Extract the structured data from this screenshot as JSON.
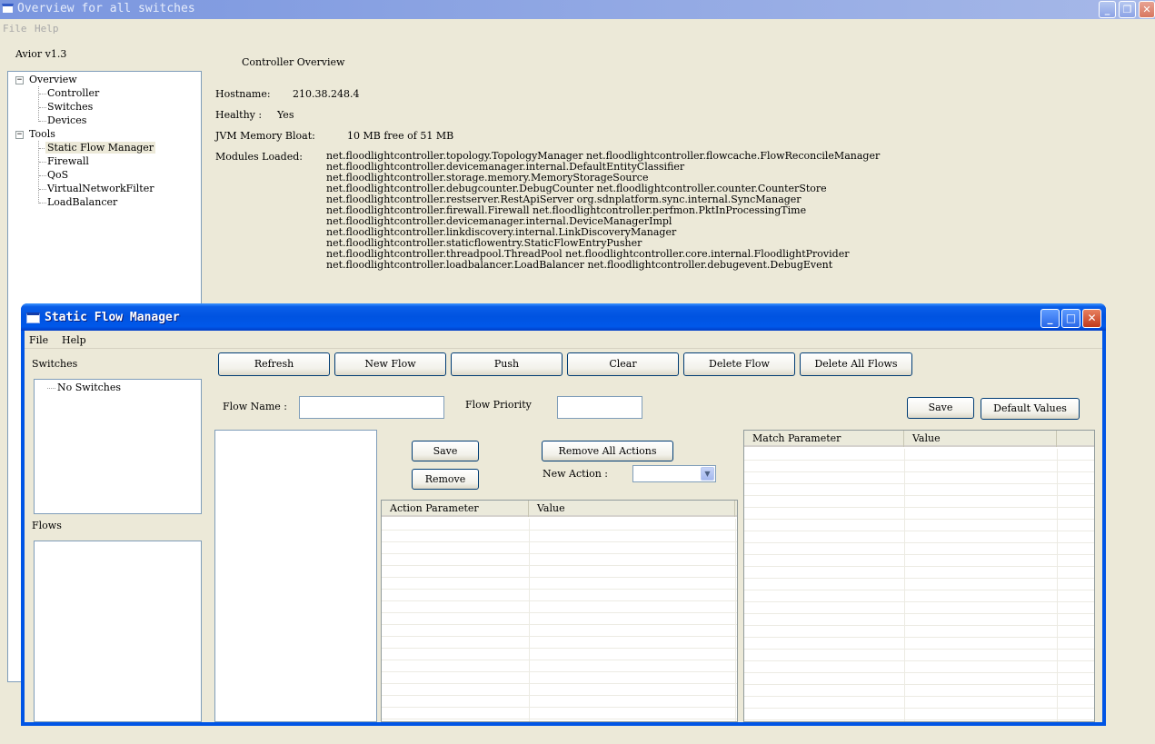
{
  "main_window": {
    "title": "Overview for all switches",
    "menu": [
      "File",
      "Help"
    ],
    "version_label": "Avior v1.3",
    "tree": {
      "overview": {
        "label": "Overview",
        "children": [
          "Controller",
          "Switches",
          "Devices"
        ]
      },
      "tools": {
        "label": "Tools",
        "children": [
          "Static Flow Manager",
          "Firewall",
          "QoS",
          "VirtualNetworkFilter",
          "LoadBalancer"
        ],
        "selected": "Static Flow Manager"
      }
    },
    "overview": {
      "heading": "Controller Overview",
      "hostname_label": "Hostname:",
      "hostname_value": "210.38.248.4",
      "healthy_label": "Healthy :",
      "healthy_value": "Yes",
      "memory_label": "JVM Memory Bloat:",
      "memory_value": "10 MB free of 51 MB",
      "modules_label": "Modules Loaded:",
      "modules": [
        "net.floodlightcontroller.topology.TopologyManager net.floodlightcontroller.flowcache.FlowReconcileManager",
        "net.floodlightcontroller.devicemanager.internal.DefaultEntityClassifier",
        "net.floodlightcontroller.storage.memory.MemoryStorageSource",
        "net.floodlightcontroller.debugcounter.DebugCounter net.floodlightcontroller.counter.CounterStore",
        "net.floodlightcontroller.restserver.RestApiServer org.sdnplatform.sync.internal.SyncManager",
        "net.floodlightcontroller.firewall.Firewall net.floodlightcontroller.perfmon.PktInProcessingTime",
        "net.floodlightcontroller.devicemanager.internal.DeviceManagerImpl",
        "net.floodlightcontroller.linkdiscovery.internal.LinkDiscoveryManager",
        "net.floodlightcontroller.staticflowentry.StaticFlowEntryPusher",
        "net.floodlightcontroller.threadpool.ThreadPool net.floodlightcontroller.core.internal.FloodlightProvider",
        "net.floodlightcontroller.loadbalancer.LoadBalancer net.floodlightcontroller.debugevent.DebugEvent"
      ]
    }
  },
  "sfm_window": {
    "title": "Static Flow Manager",
    "menu": [
      "File",
      "Help"
    ],
    "switches_label": "Switches",
    "switches_tree_item": "No Switches",
    "flows_label": "Flows",
    "toolbar": [
      "Refresh",
      "New Flow",
      "Push",
      "Clear",
      "Delete Flow",
      "Delete All Flows"
    ],
    "flow_name_label": "Flow Name :",
    "flow_name_value": "",
    "flow_priority_label": "Flow Priority",
    "flow_priority_value": "",
    "save_label": "Save",
    "default_values_label": "Default Values",
    "action_save_label": "Save",
    "action_remove_label": "Remove",
    "remove_all_actions_label": "Remove All Actions",
    "new_action_label": "New Action :",
    "new_action_value": "",
    "action_table": {
      "columns": [
        "Action Parameter",
        "Value"
      ]
    },
    "match_table": {
      "columns": [
        "Match Parameter",
        "Value"
      ]
    }
  },
  "colors": {
    "desktop": "#ece9d8",
    "xp_blue": "#0055e5",
    "close_red": "#c0391b"
  },
  "icons": {
    "minimize": "minimize-icon",
    "maximize": "maximize-icon",
    "restore": "restore-icon",
    "close": "close-icon",
    "dropdown": "chevron-down-icon"
  }
}
